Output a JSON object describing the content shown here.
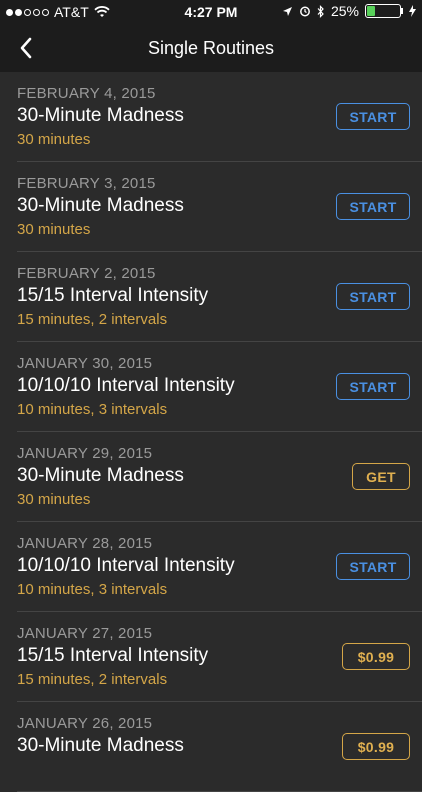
{
  "status_bar": {
    "carrier": "AT&T",
    "time": "4:27 PM",
    "battery_text": "25%",
    "battery_level": 0.25,
    "signal_bars_filled": 2,
    "signal_bars_total": 5
  },
  "nav": {
    "title": "Single Routines",
    "back_icon": "chevron-left-icon"
  },
  "colors": {
    "start_button": "#4a90e2",
    "gold": "#d4a648",
    "background": "#2b2b2b"
  },
  "routines": [
    {
      "date": "FEBRUARY 4, 2015",
      "title": "30-Minute Madness",
      "subtitle": "30 minutes",
      "action": "START",
      "action_type": "start"
    },
    {
      "date": "FEBRUARY 3, 2015",
      "title": "30-Minute Madness",
      "subtitle": "30 minutes",
      "action": "START",
      "action_type": "start"
    },
    {
      "date": "FEBRUARY 2, 2015",
      "title": "15/15 Interval Intensity",
      "subtitle": "15 minutes, 2 intervals",
      "action": "START",
      "action_type": "start"
    },
    {
      "date": "JANUARY 30, 2015",
      "title": "10/10/10 Interval Intensity",
      "subtitle": "10 minutes, 3 intervals",
      "action": "START",
      "action_type": "start"
    },
    {
      "date": "JANUARY 29, 2015",
      "title": "30-Minute Madness",
      "subtitle": "30 minutes",
      "action": "GET",
      "action_type": "get"
    },
    {
      "date": "JANUARY 28, 2015",
      "title": "10/10/10 Interval Intensity",
      "subtitle": "10 minutes, 3 intervals",
      "action": "START",
      "action_type": "start"
    },
    {
      "date": "JANUARY 27, 2015",
      "title": "15/15 Interval Intensity",
      "subtitle": "15 minutes, 2 intervals",
      "action": "$0.99",
      "action_type": "price"
    },
    {
      "date": "JANUARY 26, 2015",
      "title": "30-Minute Madness",
      "subtitle": "",
      "action": "$0.99",
      "action_type": "price"
    }
  ]
}
